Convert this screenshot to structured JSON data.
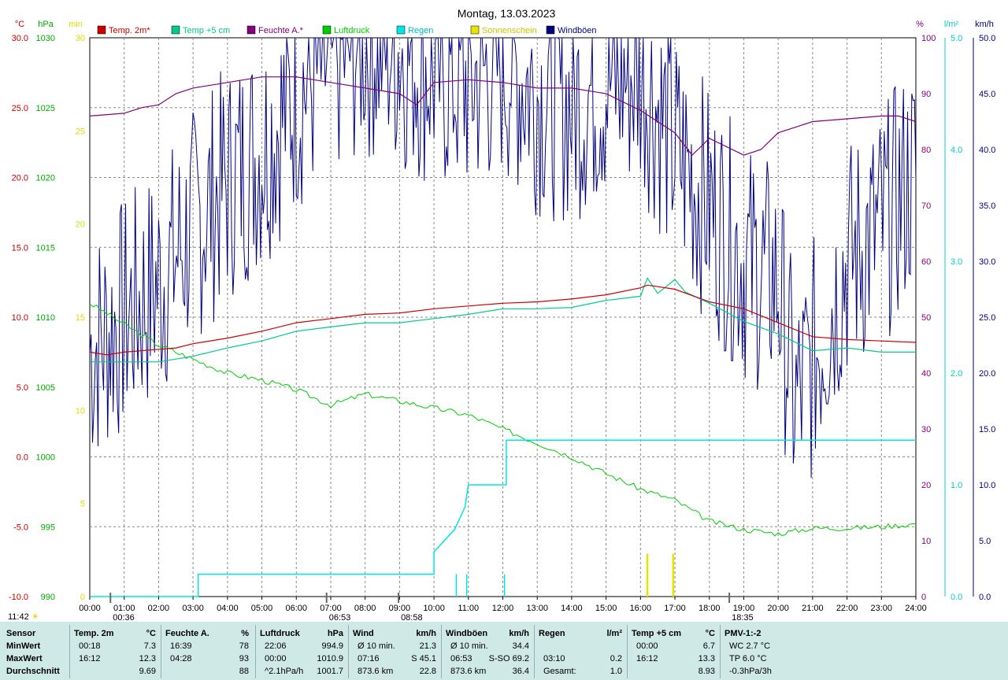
{
  "chart_data": {
    "type": "line",
    "title": "Montag, 13.03.2023",
    "x_ticks": [
      "00:00",
      "01:00",
      "02:00",
      "03:00",
      "04:00",
      "05:00",
      "06:00",
      "07:00",
      "08:00",
      "09:00",
      "10:00",
      "11:00",
      "12:00",
      "13:00",
      "14:00",
      "15:00",
      "16:00",
      "17:00",
      "18:00",
      "19:00",
      "20:00",
      "21:00",
      "22:00",
      "23:00",
      "24:00"
    ],
    "axes": {
      "temp": {
        "unit": "°C",
        "ticks": [
          "30.0",
          "25.0",
          "20.0",
          "15.0",
          "10.0",
          "5.0",
          "0.0",
          "-5.0",
          "-10.0"
        ],
        "min": -10,
        "max": 30,
        "color": "#cc0000"
      },
      "pressure": {
        "unit": "hPa",
        "ticks": [
          "1030",
          "1025",
          "1020",
          "1015",
          "1010",
          "1005",
          "1000",
          "995",
          "990"
        ],
        "min": 990,
        "max": 1030,
        "color": "#00aa00"
      },
      "sunshine": {
        "unit": "min",
        "ticks": [
          "30",
          "25",
          "20",
          "15",
          "10",
          "5",
          "0"
        ],
        "min": 0,
        "max": 30,
        "color": "#dddd00"
      },
      "humidity": {
        "unit": "%",
        "ticks": [
          "100",
          "90",
          "80",
          "70",
          "60",
          "50",
          "40",
          "30",
          "20",
          "10",
          "0"
        ],
        "min": 0,
        "max": 100,
        "color": "#800080"
      },
      "rain": {
        "unit": "l/m²",
        "ticks": [
          "5.0",
          "4.0",
          "3.0",
          "2.0",
          "1.0",
          "0.0"
        ],
        "min": 0,
        "max": 5,
        "color": "#00cccc"
      },
      "wind": {
        "unit": "km/h",
        "ticks": [
          "50.0",
          "45.0",
          "40.0",
          "35.0",
          "30.0",
          "25.0",
          "20.0",
          "15.0",
          "10.0",
          "5.0",
          "0.0"
        ],
        "min": 0,
        "max": 50,
        "color": "#000080"
      }
    },
    "legend": [
      {
        "name": "Temp. 2m*",
        "color": "#cc0000"
      },
      {
        "name": "Temp +5 cm",
        "color": "#00cc88"
      },
      {
        "name": "Feuchte A.*",
        "color": "#800080"
      },
      {
        "name": "Luftdruck",
        "color": "#00cc00"
      },
      {
        "name": "Regen",
        "color": "#00e5e5"
      },
      {
        "name": "Sonnenschein",
        "color": "#e5e500"
      },
      {
        "name": "Windböen",
        "color": "#000080"
      }
    ],
    "series": [
      {
        "name": "Temp. 2m*",
        "axis": "temp",
        "color": "#cc0000",
        "points": [
          [
            0,
            7.5
          ],
          [
            0.5,
            7.3
          ],
          [
            1,
            7.5
          ],
          [
            2,
            7.7
          ],
          [
            2.5,
            7.8
          ],
          [
            3,
            8.1
          ],
          [
            4,
            8.5
          ],
          [
            5,
            9.0
          ],
          [
            5.5,
            9.3
          ],
          [
            6,
            9.6
          ],
          [
            7,
            9.9
          ],
          [
            8,
            10.2
          ],
          [
            9,
            10.3
          ],
          [
            10,
            10.6
          ],
          [
            11,
            10.8
          ],
          [
            12,
            11.0
          ],
          [
            13,
            11.1
          ],
          [
            14,
            11.3
          ],
          [
            15,
            11.6
          ],
          [
            16,
            12.1
          ],
          [
            16.2,
            12.3
          ],
          [
            17,
            12.0
          ],
          [
            18,
            11.1
          ],
          [
            19,
            10.6
          ],
          [
            20,
            9.6
          ],
          [
            21,
            8.6
          ],
          [
            22,
            8.4
          ],
          [
            23,
            8.3
          ],
          [
            24,
            8.2
          ]
        ]
      },
      {
        "name": "Temp +5 cm",
        "axis": "temp",
        "color": "#00cc88",
        "points": [
          [
            0,
            6.8
          ],
          [
            2,
            6.8
          ],
          [
            3,
            7.2
          ],
          [
            4,
            7.8
          ],
          [
            5,
            8.3
          ],
          [
            6,
            9.0
          ],
          [
            7,
            9.3
          ],
          [
            8,
            9.6
          ],
          [
            9,
            9.6
          ],
          [
            10,
            9.9
          ],
          [
            11,
            10.2
          ],
          [
            12,
            10.6
          ],
          [
            13,
            10.6
          ],
          [
            14,
            10.7
          ],
          [
            15,
            11.2
          ],
          [
            16,
            11.5
          ],
          [
            16.2,
            12.8
          ],
          [
            16.5,
            11.7
          ],
          [
            17,
            12.7
          ],
          [
            17.3,
            11.8
          ],
          [
            18,
            11.0
          ],
          [
            19,
            9.7
          ],
          [
            20,
            8.8
          ],
          [
            21,
            7.6
          ],
          [
            22,
            7.8
          ],
          [
            23,
            7.5
          ],
          [
            24,
            7.5
          ]
        ]
      },
      {
        "name": "Feuchte A.*",
        "axis": "humidity",
        "color": "#800080",
        "points": [
          [
            0,
            86
          ],
          [
            1,
            86.5
          ],
          [
            1.5,
            87.5
          ],
          [
            2,
            88
          ],
          [
            2.5,
            90
          ],
          [
            3,
            91
          ],
          [
            4,
            92
          ],
          [
            5,
            93
          ],
          [
            6,
            93
          ],
          [
            7,
            92
          ],
          [
            8,
            91
          ],
          [
            9,
            90
          ],
          [
            9.5,
            88
          ],
          [
            10,
            92
          ],
          [
            11,
            92.5
          ],
          [
            12,
            92
          ],
          [
            13,
            91
          ],
          [
            14,
            91
          ],
          [
            15,
            90
          ],
          [
            16,
            87
          ],
          [
            17,
            83
          ],
          [
            17.5,
            79
          ],
          [
            18,
            82
          ],
          [
            19,
            79
          ],
          [
            19.5,
            80
          ],
          [
            20,
            83
          ],
          [
            21,
            85
          ],
          [
            22,
            85.5
          ],
          [
            23,
            86
          ],
          [
            23.5,
            86
          ],
          [
            24,
            85
          ]
        ]
      },
      {
        "name": "Luftdruck",
        "axis": "pressure",
        "color": "#00cc00",
        "points": [
          [
            0,
            1011
          ],
          [
            1,
            1009.5
          ],
          [
            2,
            1008
          ],
          [
            3,
            1007
          ],
          [
            4,
            1006
          ],
          [
            5,
            1005.5
          ],
          [
            6,
            1004.8
          ],
          [
            7,
            1003.7
          ],
          [
            8,
            1004.5
          ],
          [
            9,
            1004
          ],
          [
            10,
            1003.5
          ],
          [
            11,
            1003
          ],
          [
            12,
            1002
          ],
          [
            13,
            1001
          ],
          [
            14,
            1000
          ],
          [
            15,
            998.8
          ],
          [
            16,
            997.7
          ],
          [
            17,
            996.9
          ],
          [
            18,
            995.4
          ],
          [
            19,
            994.8
          ],
          [
            20,
            994.5
          ],
          [
            21,
            994.9
          ],
          [
            22,
            994.9
          ],
          [
            23,
            995
          ],
          [
            24,
            995.2
          ]
        ]
      },
      {
        "name": "Regen",
        "axis": "rain",
        "color": "#00e5e5",
        "points": [
          [
            0,
            0
          ],
          [
            3.15,
            0
          ],
          [
            3.15,
            0.2
          ],
          [
            10,
            0.2
          ],
          [
            10,
            0.4
          ],
          [
            10.6,
            0.6
          ],
          [
            10.9,
            0.8
          ],
          [
            11,
            1.0
          ],
          [
            12.1,
            1.0
          ],
          [
            12.1,
            1.4
          ],
          [
            24,
            1.4
          ]
        ]
      },
      {
        "name": "Sonnenschein",
        "axis": "sunshine",
        "color": "#e5e500",
        "points": [
          [
            16.2,
            0
          ],
          [
            16.2,
            2.2
          ],
          [
            16.95,
            0
          ],
          [
            16.95,
            2.2
          ]
        ]
      },
      {
        "name": "Windböen",
        "axis": "wind",
        "color": "#000080",
        "points": [
          [
            0,
            22
          ],
          [
            1,
            25
          ],
          [
            2,
            28
          ],
          [
            3,
            33
          ],
          [
            4,
            37
          ],
          [
            5,
            40
          ],
          [
            6,
            45
          ],
          [
            7,
            48
          ],
          [
            8,
            50
          ],
          [
            9,
            49
          ],
          [
            10,
            47
          ],
          [
            11,
            46
          ],
          [
            12,
            48
          ],
          [
            13,
            45
          ],
          [
            14,
            44
          ],
          [
            15,
            46
          ],
          [
            16,
            47
          ],
          [
            17,
            40
          ],
          [
            18,
            35
          ],
          [
            19,
            30
          ],
          [
            20,
            28
          ],
          [
            20.5,
            17
          ],
          [
            21,
            21
          ],
          [
            22,
            30
          ],
          [
            23,
            33
          ],
          [
            24,
            38
          ]
        ]
      }
    ],
    "annotations": [
      {
        "label": "00:36",
        "x": 0.6
      },
      {
        "label": "06:53",
        "x": 6.88
      },
      {
        "label": "08:58",
        "x": 8.97
      },
      {
        "label": "18:35",
        "x": 18.58
      }
    ],
    "grid": true
  },
  "sun": {
    "left_label": "11:42"
  },
  "stats": {
    "rows": [
      "Sensor",
      "MinWert",
      "MaxWert",
      "Durchschnitt"
    ],
    "columns": [
      {
        "title": "Temp. 2m",
        "unit": "°C",
        "left": [
          "00:18",
          "16:12",
          ""
        ],
        "right": [
          "7.3",
          "12.3",
          "9.69"
        ]
      },
      {
        "title": "Feuchte A.",
        "unit": "%",
        "left": [
          "16:39",
          "04:28",
          ""
        ],
        "right": [
          "78",
          "93",
          "88"
        ]
      },
      {
        "title": "Luftdruck",
        "unit": "hPa",
        "left": [
          "22:06",
          "00:00",
          "^2.1hPa/h"
        ],
        "right": [
          "994.9",
          "1010.9",
          "1001.7"
        ]
      },
      {
        "title": "Wind",
        "unit": "km/h",
        "left": [
          "Ø 10 min.",
          "07:16",
          "873.6 km"
        ],
        "right": [
          "21.3",
          "S 45.1",
          "22.8"
        ]
      },
      {
        "title": "Windböen",
        "unit": "km/h",
        "left": [
          "Ø 10 min.",
          "06:53",
          "873.6 km"
        ],
        "right": [
          "34.4",
          "S-SO 69.2",
          "36.4"
        ]
      },
      {
        "title": "Regen",
        "unit": "l/m²",
        "left": [
          "",
          "03:10",
          "Gesamt:"
        ],
        "right": [
          "",
          "0.2",
          "1.0"
        ]
      },
      {
        "title": "Temp +5 cm",
        "unit": "°C",
        "left": [
          "00:00",
          "16:12",
          ""
        ],
        "right": [
          "6.7",
          "13.3",
          "8.93"
        ]
      },
      {
        "title": "PMV-1:-2",
        "unit": "",
        "left": [
          "WC 2.7 °C",
          "TP 6.0 °C",
          "-0.3hPa/3h"
        ],
        "right": [
          "",
          "",
          ""
        ]
      }
    ]
  }
}
